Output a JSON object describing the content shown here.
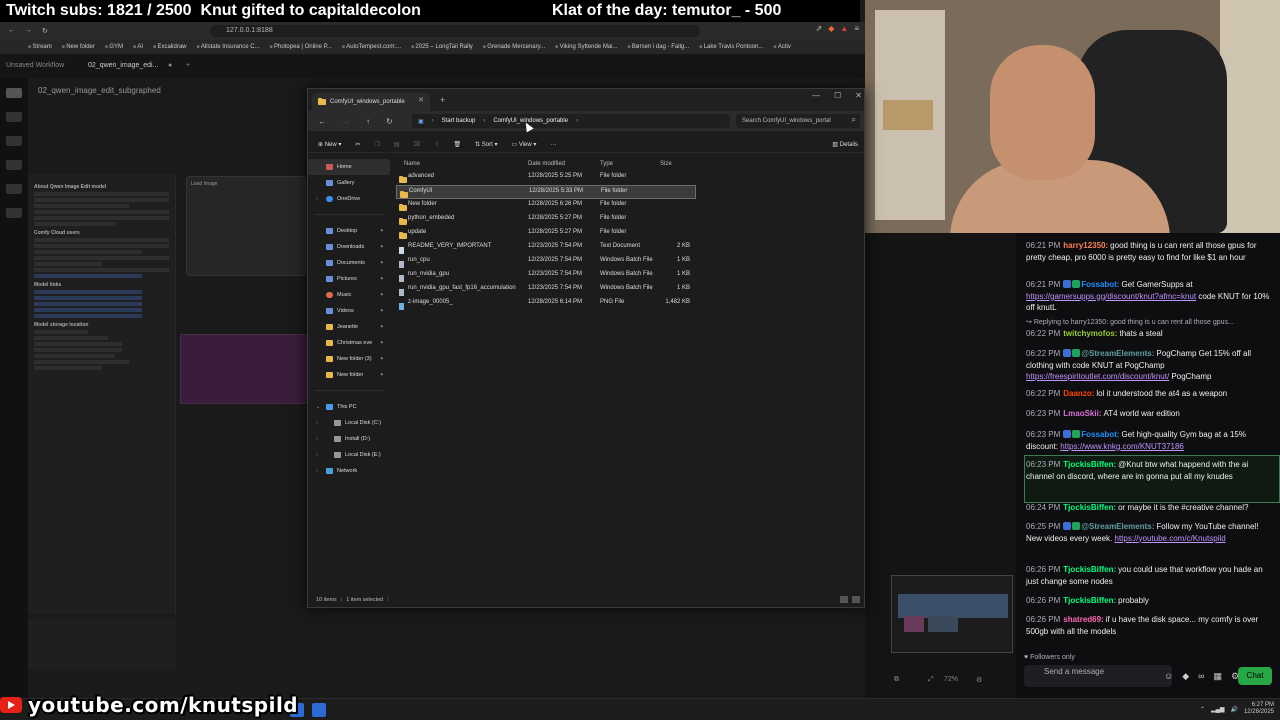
{
  "overlay": {
    "subs": "Twitch subs: 1821 / 2500",
    "gift": "Knut gifted to capitaldecolon",
    "klat": "Klat of the day: temutor_ - 500",
    "youtube": "youtube.com/knutspild"
  },
  "browser": {
    "url": "127.0.0.1:8188",
    "bookmarks": [
      "Stream",
      "New folder",
      "GYM",
      "AI",
      "Excalidraw",
      "Allstate Insurance C...",
      "Photopea | Online P...",
      "AutoTempest.com:...",
      "2025 – LongTail Rally",
      "Grenade Mercenary...",
      "Viking Syttende Mai...",
      "Børsen i dag - Fallg...",
      "Lake Travis Pontoon...",
      "Activ"
    ]
  },
  "comfy": {
    "tab1": "Unsaved Workflow",
    "tab2": "02_qwen_image_edi...",
    "subgraph": "02_qwen_image_edit_subgraphed",
    "doc_heading": "About Qwen Image Edit model",
    "doc_cloud": "Comfy Cloud users",
    "doc_models": "Model links",
    "doc_storage": "Model storage location",
    "load_image": "Load Image"
  },
  "explorer": {
    "tab_title": "ComfyUI_windows_portable",
    "crumbs": [
      "Start backup",
      "ComfyUI_windows_portable"
    ],
    "search_placeholder": "Search ComfyUI_windows_portal",
    "cmd": {
      "new": "New",
      "sort": "Sort",
      "view": "View",
      "details": "Details"
    },
    "sidebar": {
      "quick": [
        {
          "label": "Home",
          "icon": "home"
        },
        {
          "label": "Gallery",
          "icon": "gallery"
        },
        {
          "label": "OneDrive",
          "icon": "cloud"
        }
      ],
      "pinned": [
        {
          "label": "Desktop",
          "icon": "desktop"
        },
        {
          "label": "Downloads",
          "icon": "download"
        },
        {
          "label": "Documents",
          "icon": "documents"
        },
        {
          "label": "Pictures",
          "icon": "pictures"
        },
        {
          "label": "Music",
          "icon": "music"
        },
        {
          "label": "Videos",
          "icon": "videos"
        },
        {
          "label": "Jeanette",
          "icon": "folder"
        },
        {
          "label": "Christmas eve",
          "icon": "folder"
        },
        {
          "label": "New folder (3)",
          "icon": "folder"
        },
        {
          "label": "New folder",
          "icon": "folder"
        }
      ],
      "this_pc": "This PC",
      "drives": [
        "Local Disk (C:)",
        "Install (D:)",
        "Local Disk (E:)"
      ],
      "network": "Network"
    },
    "columns": {
      "name": "Name",
      "date": "Date modified",
      "type": "Type",
      "size": "Size"
    },
    "files": [
      {
        "name": "advanced",
        "date": "12/28/2025 5:25 PM",
        "type": "File folder",
        "size": "",
        "kind": "folder"
      },
      {
        "name": "ComfyUI",
        "date": "12/28/2025 5:33 PM",
        "type": "File folder",
        "size": "",
        "kind": "folder"
      },
      {
        "name": "New folder",
        "date": "12/28/2025 6:26 PM",
        "type": "File folder",
        "size": "",
        "kind": "folder"
      },
      {
        "name": "python_embeded",
        "date": "12/28/2025 5:27 PM",
        "type": "File folder",
        "size": "",
        "kind": "folder"
      },
      {
        "name": "update",
        "date": "12/28/2025 5:27 PM",
        "type": "File folder",
        "size": "",
        "kind": "folder"
      },
      {
        "name": "README_VERY_IMPORTANT",
        "date": "12/23/2025 7:54 PM",
        "type": "Text Document",
        "size": "2 KB",
        "kind": "file"
      },
      {
        "name": "run_cpu",
        "date": "12/23/2025 7:54 PM",
        "type": "Windows Batch File",
        "size": "1 KB",
        "kind": "bat"
      },
      {
        "name": "run_nvidia_gpu",
        "date": "12/23/2025 7:54 PM",
        "type": "Windows Batch File",
        "size": "1 KB",
        "kind": "bat"
      },
      {
        "name": "run_nvidia_gpu_fast_fp16_accumulation",
        "date": "12/23/2025 7:54 PM",
        "type": "Windows Batch File",
        "size": "1 KB",
        "kind": "bat"
      },
      {
        "name": "z-image_00005_",
        "date": "12/28/2025 6:14 PM",
        "type": "PNG File",
        "size": "1,482 KB",
        "kind": "png"
      }
    ],
    "status": {
      "count": "10 items",
      "selected": "1 item selected"
    }
  },
  "chat": {
    "messages": [
      {
        "time": "06:21 PM",
        "user": "harry12350:",
        "user_color": "#ff7f50",
        "text": "good thing is u can rent all those gpus for pretty cheap, pro 6000 is pretty easy to find for like $1 an hour"
      },
      {
        "time": "06:21 PM",
        "user": "Fossabot:",
        "user_color": "#1e90ff",
        "text": "Get GamerSupps at",
        "link": "https://gamersupps.gg/discount/knut?afmc=knut",
        "text2": "code KNUT for 10% off knutL"
      },
      {
        "reply": "Replying to harry12350: good thing is u can rent all those gpus..."
      },
      {
        "time": "06:22 PM",
        "user": "twitchymofos:",
        "user_color": "#9acd32",
        "text": "thats a steal"
      },
      {
        "time": "06:22 PM",
        "user": "@StreamElements:",
        "user_color": "#5f9ea0",
        "text": "PogChamp Get 15% off all clothing with code KNUT at PogChamp",
        "link": "https://freespiritoutlet.com/discount/knut/",
        "text2": "PogChamp"
      },
      {
        "time": "06:22 PM",
        "user": "Daanzo:",
        "user_color": "#ff4500",
        "text": "lol it understood the at4 as a weapon"
      },
      {
        "time": "06:23 PM",
        "user": "LmaoSkii:",
        "user_color": "#da70d6",
        "text": "AT4 world war edition"
      },
      {
        "time": "06:23 PM",
        "user": "Fossabot:",
        "user_color": "#1e90ff",
        "text": "Get high-quality Gym bag at a 15% discount:",
        "link": "https://www.knkg.com/KNUT37186"
      },
      {
        "time": "06:23 PM",
        "user": "TjockisBiffen:",
        "user_color": "#00ff7f",
        "text": "@Knut btw what happend with the ai channel on discord, where are im gonna put all my knudes"
      },
      {
        "time": "06:24 PM",
        "user": "TjockisBiffen:",
        "user_color": "#00ff7f",
        "text": "or maybe it is the #creative channel?"
      },
      {
        "time": "06:25 PM",
        "user": "@StreamElements:",
        "user_color": "#5f9ea0",
        "text": "Follow my YouTube channel! New videos every week.",
        "link": "https://youtube.com/c/Knutspild"
      },
      {
        "time": "06:26 PM",
        "user": "TjockisBiffen:",
        "user_color": "#00ff7f",
        "text": "you could use that workflow you hade an just change some nodes"
      },
      {
        "time": "06:26 PM",
        "user": "TjockisBiffen:",
        "user_color": "#00ff7f",
        "text": "probably"
      },
      {
        "time": "06:26 PM",
        "user": "shatred69:",
        "user_color": "#ff69b4",
        "text": "if u have the disk space... my comfy is over 500gb with all the models"
      }
    ],
    "followers_only": "Followers only",
    "placeholder": "Send a message",
    "chat_button": "Chat"
  },
  "taskbar": {
    "time": "6:27 PM",
    "date": "12/28/2025"
  },
  "player": {
    "zoom": "72%"
  }
}
